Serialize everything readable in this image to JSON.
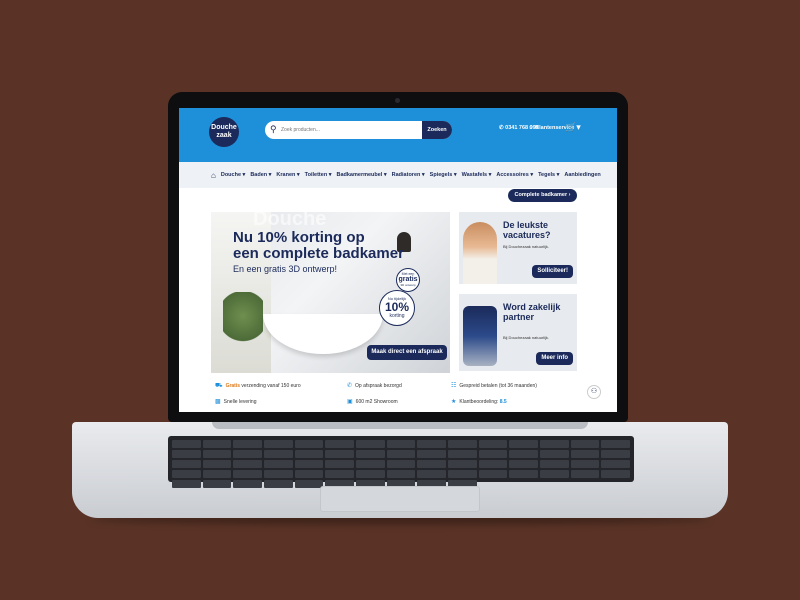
{
  "header": {
    "logo_line1": "Douche",
    "logo_line2": "zaak",
    "search_placeholder": "Zoek producten...",
    "search_button": "Zoeken",
    "phone": "0341 768 999",
    "customer_service": "Klantenservice"
  },
  "nav": {
    "items": [
      "Douche",
      "Baden",
      "Kranen",
      "Toiletten",
      "Badkamermeubel",
      "Radiatoren",
      "Spiegels",
      "Wastafels",
      "Accessoires",
      "Tegels",
      "Aanbiedingen"
    ]
  },
  "complete_badkamer_btn": "Complete badkamer",
  "hero": {
    "watermark": "Douche",
    "title_line1": "Nu 10% korting op",
    "title_line2": "een complete badkamer",
    "subtitle": "En een gratis 3D ontwerp!",
    "gratis_badge": {
      "top": "Met een",
      "mid": "gratis",
      "bot": "3D ontwerp"
    },
    "discount_badge": {
      "top": "Nu tijdelijk",
      "pct": "10%",
      "bot": "korting"
    },
    "cta": "Maak direct een afspraak"
  },
  "cards": [
    {
      "title": "De leukste vacatures?",
      "sub": "Bij Douchezaak natuurlijk.",
      "button": "Solliciteer!"
    },
    {
      "title": "Word zakelijk partner",
      "sub": "Bij Douchezaak natuurlijk.",
      "button": "Meer info"
    }
  ],
  "usps": {
    "shipping_prefix": "Gratis",
    "shipping_rest": "verzending vanaf 150 euro",
    "appointment": "Op afspraak bezorgd",
    "spread_payment": "Gespreid betalen (tot 36 maanden)",
    "fast_delivery": "Snelle levering",
    "showroom": "600 m2 Showroom",
    "rating_label": "Klantbeoordeling:",
    "rating_value": "8.5"
  },
  "colors": {
    "primary": "#1e8fd9",
    "navy": "#1b2a5a",
    "background": "#5a3326",
    "accent": "#e07a1a"
  }
}
